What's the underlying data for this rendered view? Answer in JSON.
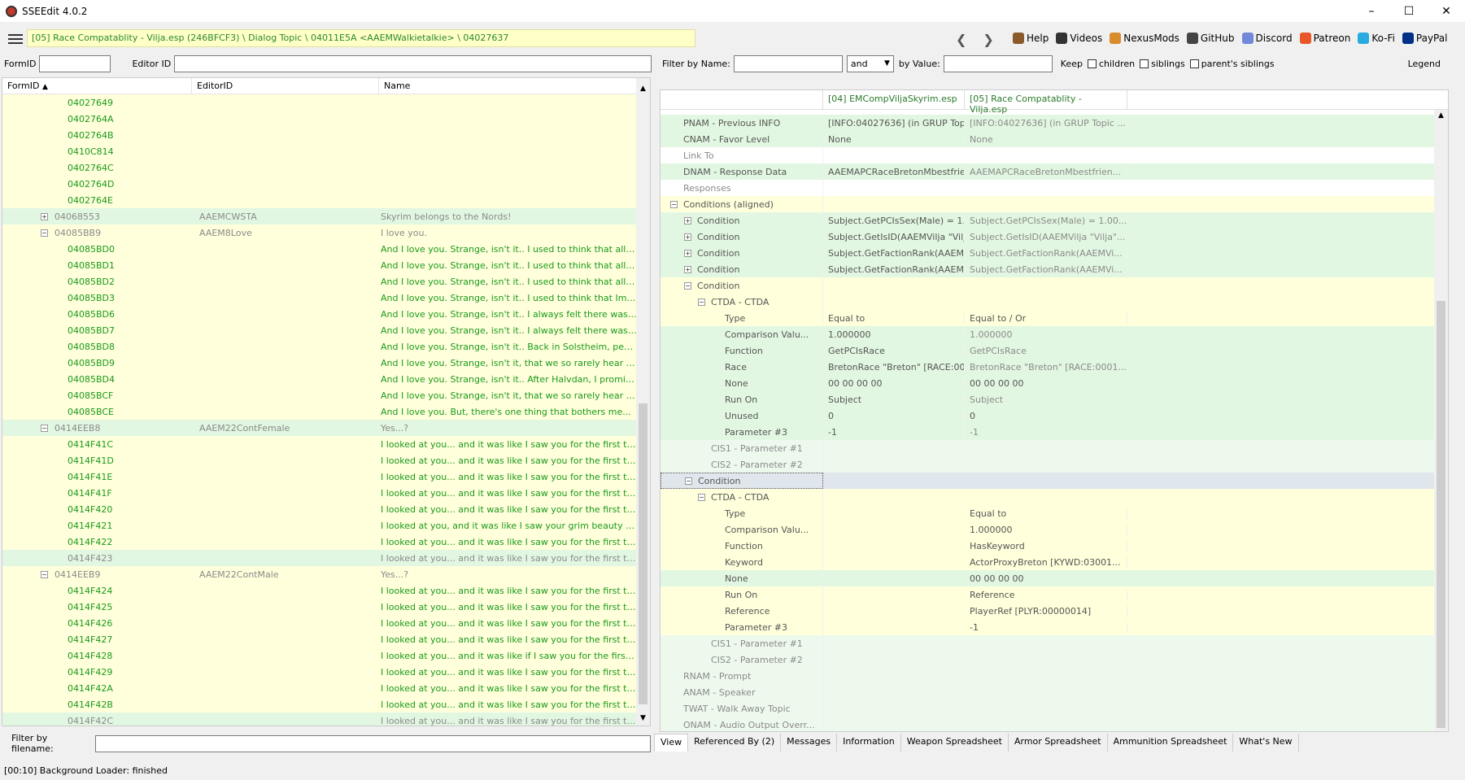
{
  "window": {
    "title": "SSEEdit 4.0.2",
    "minimize": "–",
    "maximize": "☐",
    "close": "✕"
  },
  "toolbar": {
    "path": "[05] Race Compatablity - Vilja.esp (246BFCF3) \\ Dialog Topic \\ 04011E5A <AAEMWalkietalkie> \\ 04027637",
    "back": "❮",
    "forward": "❯",
    "links": [
      {
        "label": "Help",
        "icon": "book-icon",
        "color": "#8b5a2b"
      },
      {
        "label": "Videos",
        "icon": "videos-icon",
        "color": "#333"
      },
      {
        "label": "NexusMods",
        "icon": "nexusmods-icon",
        "color": "#d98c2b"
      },
      {
        "label": "GitHub",
        "icon": "github-icon",
        "color": "#444"
      },
      {
        "label": "Discord",
        "icon": "discord-icon",
        "color": "#7289da"
      },
      {
        "label": "Patreon",
        "icon": "patreon-icon",
        "color": "#e8562a"
      },
      {
        "label": "Ko-Fi",
        "icon": "kofi-icon",
        "color": "#29abe0"
      },
      {
        "label": "PayPal",
        "icon": "paypal-icon",
        "color": "#003087"
      }
    ]
  },
  "left": {
    "formid_label": "FormID",
    "editorid_label": "Editor ID",
    "columns": [
      "FormID",
      "EditorID",
      "Name"
    ],
    "rows": [
      {
        "id": "04027649",
        "eid": "",
        "name": "",
        "bg": "y",
        "lvl": 2,
        "idc": "tg",
        "nc": "tg"
      },
      {
        "id": "0402764A",
        "eid": "",
        "name": "",
        "bg": "y",
        "lvl": 2,
        "idc": "tg",
        "nc": "tg"
      },
      {
        "id": "0402764B",
        "eid": "",
        "name": "",
        "bg": "y",
        "lvl": 2,
        "idc": "tg",
        "nc": "tg"
      },
      {
        "id": "0410C814",
        "eid": "",
        "name": "",
        "bg": "y",
        "lvl": 2,
        "idc": "tg",
        "nc": "tg"
      },
      {
        "id": "0402764C",
        "eid": "",
        "name": "",
        "bg": "y",
        "lvl": 2,
        "idc": "tg",
        "nc": "tg"
      },
      {
        "id": "0402764D",
        "eid": "",
        "name": "",
        "bg": "y",
        "lvl": 2,
        "idc": "tg",
        "nc": "tg"
      },
      {
        "id": "0402764E",
        "eid": "",
        "name": "",
        "bg": "y",
        "lvl": 2,
        "idc": "tg",
        "nc": "tg"
      },
      {
        "id": "04068553",
        "eid": "AAEMCWSTA",
        "name": "Skyrim belongs to the Nords!",
        "bg": "g",
        "lvl": 1,
        "pm": "+",
        "idc": "tgr",
        "nc": "tgr"
      },
      {
        "id": "04085BB9",
        "eid": "AAEM8Love",
        "name": "I love you.",
        "bg": "y",
        "lvl": 1,
        "pm": "−",
        "idc": "tgr",
        "nc": "tgr"
      },
      {
        "id": "04085BD0",
        "eid": "",
        "name": "And I love you. Strange, isn't it.. I used to think that all B...",
        "bg": "y",
        "lvl": 2,
        "idc": "tg",
        "nc": "tg"
      },
      {
        "id": "04085BD1",
        "eid": "",
        "name": "And I love you. Strange, isn't it.. I used to think that all A...",
        "bg": "y",
        "lvl": 2,
        "idc": "tg",
        "nc": "tg"
      },
      {
        "id": "04085BD2",
        "eid": "",
        "name": "And I love you. Strange, isn't it.. I used to think that all D...",
        "bg": "y",
        "lvl": 2,
        "idc": "tg",
        "nc": "tg"
      },
      {
        "id": "04085BD3",
        "eid": "",
        "name": "And I love you. Strange, isn't it.. I used to think that Imp...",
        "bg": "y",
        "lvl": 2,
        "idc": "tg",
        "nc": "tg"
      },
      {
        "id": "04085BD6",
        "eid": "",
        "name": "And I love you. Strange, isn't it.. I always felt there was s...",
        "bg": "y",
        "lvl": 2,
        "idc": "tg",
        "nc": "tg"
      },
      {
        "id": "04085BD7",
        "eid": "",
        "name": "And I love you. Strange, isn't it.. I always felt there was s...",
        "bg": "y",
        "lvl": 2,
        "idc": "tg",
        "nc": "tg"
      },
      {
        "id": "04085BD8",
        "eid": "",
        "name": "And I love you. Strange, isn't it.. Back in Solstheim, peopl...",
        "bg": "y",
        "lvl": 2,
        "idc": "tg",
        "nc": "tg"
      },
      {
        "id": "04085BD9",
        "eid": "",
        "name": "And I love you. Strange, isn't it, that we so rarely hear of ...",
        "bg": "y",
        "lvl": 2,
        "idc": "tg",
        "nc": "tg"
      },
      {
        "id": "04085BD4",
        "eid": "",
        "name": "And I love you. Strange, isn't it.. After Halvdan, I promis...",
        "bg": "y",
        "lvl": 2,
        "idc": "tg",
        "nc": "tg"
      },
      {
        "id": "04085BCF",
        "eid": "",
        "name": "And I love you. Strange, isn't it, that we so rarely hear of ...",
        "bg": "y",
        "lvl": 2,
        "idc": "tg",
        "nc": "tg"
      },
      {
        "id": "04085BCE",
        "eid": "",
        "name": "And I love you. But, there's one thing that bothers me...",
        "bg": "y",
        "lvl": 2,
        "idc": "tg",
        "nc": "tg"
      },
      {
        "id": "0414EEB8",
        "eid": "AAEM22ContFemale",
        "name": "Yes...?",
        "bg": "g",
        "lvl": 1,
        "pm": "−",
        "idc": "tgr",
        "nc": "tgr"
      },
      {
        "id": "0414F41C",
        "eid": "",
        "name": "I looked at you... and it was like I saw you for the first ti...",
        "bg": "y",
        "lvl": 2,
        "idc": "tg",
        "nc": "tg"
      },
      {
        "id": "0414F41D",
        "eid": "",
        "name": "I looked at you... and it was like I saw you for the first ti...",
        "bg": "y",
        "lvl": 2,
        "idc": "tg",
        "nc": "tg"
      },
      {
        "id": "0414F41E",
        "eid": "",
        "name": "I looked at you... and it was like I saw you for the first ti...",
        "bg": "y",
        "lvl": 2,
        "idc": "tg",
        "nc": "tg"
      },
      {
        "id": "0414F41F",
        "eid": "",
        "name": "I looked at you... and it was like I saw you for the first ti...",
        "bg": "y",
        "lvl": 2,
        "idc": "tg",
        "nc": "tg"
      },
      {
        "id": "0414F420",
        "eid": "",
        "name": "I looked at you... and it was like I saw you for the first ti...",
        "bg": "y",
        "lvl": 2,
        "idc": "tg",
        "nc": "tg"
      },
      {
        "id": "0414F421",
        "eid": "",
        "name": "I looked at you, and it was like I saw your grim beauty fo...",
        "bg": "y",
        "lvl": 2,
        "idc": "tg",
        "nc": "tg"
      },
      {
        "id": "0414F422",
        "eid": "",
        "name": "I looked at you... and it was like I saw you for the first ti...",
        "bg": "y",
        "lvl": 2,
        "idc": "tg",
        "nc": "tg"
      },
      {
        "id": "0414F423",
        "eid": "",
        "name": "I looked at you... and it was like I saw you for the first ti...",
        "bg": "g",
        "lvl": 2,
        "idc": "tgr",
        "nc": "tgr"
      },
      {
        "id": "0414EEB9",
        "eid": "AAEM22ContMale",
        "name": "Yes...?",
        "bg": "y",
        "lvl": 1,
        "pm": "−",
        "idc": "tgr",
        "nc": "tgr"
      },
      {
        "id": "0414F424",
        "eid": "",
        "name": "I looked at you... and it was like I saw you for the first ti...",
        "bg": "y",
        "lvl": 2,
        "idc": "tg",
        "nc": "tg"
      },
      {
        "id": "0414F425",
        "eid": "",
        "name": "I looked at you... and it was like I saw you for the first ti...",
        "bg": "y",
        "lvl": 2,
        "idc": "tg",
        "nc": "tg"
      },
      {
        "id": "0414F426",
        "eid": "",
        "name": "I looked at you... and it was like I saw you for the first ti...",
        "bg": "y",
        "lvl": 2,
        "idc": "tg",
        "nc": "tg"
      },
      {
        "id": "0414F427",
        "eid": "",
        "name": "I looked at you... and it was like I saw you for the first ti...",
        "bg": "y",
        "lvl": 2,
        "idc": "tg",
        "nc": "tg"
      },
      {
        "id": "0414F428",
        "eid": "",
        "name": "I looked at you... and it was like if I saw you for the first t...",
        "bg": "y",
        "lvl": 2,
        "idc": "tg",
        "nc": "tg"
      },
      {
        "id": "0414F429",
        "eid": "",
        "name": "I looked at you... and it was like I saw you for the first ti...",
        "bg": "y",
        "lvl": 2,
        "idc": "tg",
        "nc": "tg"
      },
      {
        "id": "0414F42A",
        "eid": "",
        "name": "I looked at you... and it was like I saw you for the first ti...",
        "bg": "y",
        "lvl": 2,
        "idc": "tg",
        "nc": "tg"
      },
      {
        "id": "0414F42B",
        "eid": "",
        "name": "I looked at you... and it was like I saw you for the first ti...",
        "bg": "y",
        "lvl": 2,
        "idc": "tg",
        "nc": "tg"
      },
      {
        "id": "0414F42C",
        "eid": "",
        "name": "I looked at you... and it was like I saw you for the first ti...",
        "bg": "g",
        "lvl": 2,
        "idc": "tgr",
        "nc": "tgr"
      }
    ],
    "filter_label": "Filter by filename:"
  },
  "status": "[00:10] Background Loader: finished",
  "right": {
    "filter_name_label": "Filter by Name:",
    "and_value": "and",
    "by_value_label": "by Value:",
    "keep_label": "Keep",
    "children_label": "children",
    "siblings_label": "siblings",
    "parents_siblings_label": "parent's siblings",
    "legend_label": "Legend",
    "col1": "[04] EMCompViljaSkyrim.esp",
    "col2": "[05] Race Compatablity - Vilja.esp",
    "rows": [
      {
        "k": "PNAM - Previous INFO",
        "v1": "[INFO:04027636] (in GRUP Topic ...",
        "v2": "[INFO:04027636] (in GRUP Topic ...",
        "bg": "g",
        "lvl": 0,
        "kc": "tbk",
        "c1": "tbk",
        "c2": "tgr"
      },
      {
        "k": "CNAM - Favor Level",
        "v1": "None",
        "v2": "None",
        "bg": "g",
        "lvl": 0,
        "kc": "tbk",
        "c1": "tbk",
        "c2": "tgr"
      },
      {
        "k": "Link To",
        "v1": "",
        "v2": "",
        "bg": "w",
        "lvl": 0,
        "kc": "tgr",
        "c1": "tbk",
        "c2": "tgr"
      },
      {
        "k": "DNAM - Response Data",
        "v1": "AAEMAPCRaceBretonMbestfrien...",
        "v2": "AAEMAPCRaceBretonMbestfrien...",
        "bg": "g",
        "lvl": 0,
        "kc": "tbk",
        "c1": "tbk",
        "c2": "tgr"
      },
      {
        "k": "Responses",
        "v1": "",
        "v2": "",
        "bg": "w",
        "lvl": 0,
        "kc": "tgr",
        "c1": "tbk",
        "c2": "tgr"
      },
      {
        "k": "Conditions (aligned)",
        "v1": "",
        "v2": "",
        "bg": "y",
        "lvl": 0,
        "pm": "−",
        "kc": "tbk",
        "c1": "tbk",
        "c2": "tgr"
      },
      {
        "k": "Condition",
        "v1": "Subject.GetPCIsSex(Male) = 1.00...",
        "v2": "Subject.GetPCIsSex(Male) = 1.00...",
        "bg": "g",
        "lvl": 1,
        "pm": "+",
        "kc": "tbk",
        "c1": "tbk",
        "c2": "tgr"
      },
      {
        "k": "Condition",
        "v1": "Subject.GetIsID(AAEMVilja \"Vilja\"...",
        "v2": "Subject.GetIsID(AAEMVilja \"Vilja\"...",
        "bg": "g",
        "lvl": 1,
        "pm": "+",
        "kc": "tbk",
        "c1": "tbk",
        "c2": "tgr"
      },
      {
        "k": "Condition",
        "v1": "Subject.GetFactionRank(AAEMVi...",
        "v2": "Subject.GetFactionRank(AAEMVi...",
        "bg": "g",
        "lvl": 1,
        "pm": "+",
        "kc": "tbk",
        "c1": "tbk",
        "c2": "tgr"
      },
      {
        "k": "Condition",
        "v1": "Subject.GetFactionRank(AAEMVi...",
        "v2": "Subject.GetFactionRank(AAEMVi...",
        "bg": "g",
        "lvl": 1,
        "pm": "+",
        "kc": "tbk",
        "c1": "tbk",
        "c2": "tgr"
      },
      {
        "k": "Condition",
        "v1": "",
        "v2": "",
        "bg": "y",
        "lvl": 1,
        "pm": "−",
        "kc": "tbk",
        "c1": "tbk",
        "c2": "tgr"
      },
      {
        "k": "CTDA - CTDA",
        "v1": "",
        "v2": "",
        "bg": "y",
        "lvl": 2,
        "pm": "−",
        "kc": "tbk",
        "c1": "tbk",
        "c2": "tgr"
      },
      {
        "k": "Type",
        "v1": "Equal to",
        "v2": "Equal to / Or",
        "bg": "y",
        "lvl": 3,
        "kc": "tbk",
        "c1": "tbk",
        "c2": "tbk"
      },
      {
        "k": "Comparison Valu...",
        "v1": "1.000000",
        "v2": "1.000000",
        "bg": "g",
        "lvl": 3,
        "kc": "tbk",
        "c1": "tbk",
        "c2": "tgr"
      },
      {
        "k": "Function",
        "v1": "GetPCIsRace",
        "v2": "GetPCIsRace",
        "bg": "g",
        "lvl": 3,
        "kc": "tbk",
        "c1": "tbk",
        "c2": "tgr"
      },
      {
        "k": "Race",
        "v1": "BretonRace \"Breton\" [RACE:0001...",
        "v2": "BretonRace \"Breton\" [RACE:0001...",
        "bg": "g",
        "lvl": 3,
        "kc": "tbk",
        "c1": "tbk",
        "c2": "tgr"
      },
      {
        "k": "None",
        "v1": "00 00 00 00",
        "v2": "00 00 00 00",
        "bg": "g",
        "lvl": 3,
        "kc": "tbk",
        "c1": "tbk",
        "c2": "tbk"
      },
      {
        "k": "Run On",
        "v1": "Subject",
        "v2": "Subject",
        "bg": "g",
        "lvl": 3,
        "kc": "tbk",
        "c1": "tbk",
        "c2": "tgr"
      },
      {
        "k": "Unused",
        "v1": "0",
        "v2": "0",
        "bg": "g",
        "lvl": 3,
        "kc": "tbk",
        "c1": "tbk",
        "c2": "tbk"
      },
      {
        "k": "Parameter #3",
        "v1": "-1",
        "v2": "-1",
        "bg": "g",
        "lvl": 3,
        "kc": "tbk",
        "c1": "tbk",
        "c2": "tgr"
      },
      {
        "k": "CIS1 - Parameter #1",
        "v1": "",
        "v2": "",
        "bg": "lg",
        "lvl": 2,
        "kc": "tgr",
        "c1": "tbk",
        "c2": "tgr"
      },
      {
        "k": "CIS2 - Parameter #2",
        "v1": "",
        "v2": "",
        "bg": "lg",
        "lvl": 2,
        "kc": "tgr",
        "c1": "tbk",
        "c2": "tgr"
      },
      {
        "k": "Condition",
        "v1": "",
        "v2": "",
        "bg": "sel",
        "lvl": 1,
        "pm": "−",
        "kc": "tbk",
        "c1": "tbk",
        "c2": "tgr"
      },
      {
        "k": "CTDA - CTDA",
        "v1": "",
        "v2": "",
        "bg": "y",
        "lvl": 2,
        "pm": "−",
        "kc": "tbk",
        "c1": "tbk",
        "c2": "tgr"
      },
      {
        "k": "Type",
        "v1": "",
        "v2": "Equal to",
        "bg": "y",
        "lvl": 3,
        "kc": "tbk",
        "c1": "tbk",
        "c2": "tbk"
      },
      {
        "k": "Comparison Valu...",
        "v1": "",
        "v2": "1.000000",
        "bg": "y",
        "lvl": 3,
        "kc": "tbk",
        "c1": "tbk",
        "c2": "tbk"
      },
      {
        "k": "Function",
        "v1": "",
        "v2": "HasKeyword",
        "bg": "y",
        "lvl": 3,
        "kc": "tbk",
        "c1": "tbk",
        "c2": "tbk"
      },
      {
        "k": "Keyword",
        "v1": "",
        "v2": "ActorProxyBreton [KYWD:03001...",
        "bg": "y",
        "lvl": 3,
        "kc": "tbk",
        "c1": "tbk",
        "c2": "tbk"
      },
      {
        "k": "None",
        "v1": "",
        "v2": "00 00 00 00",
        "bg": "g",
        "lvl": 3,
        "kc": "tbk",
        "c1": "tbk",
        "c2": "tbk"
      },
      {
        "k": "Run On",
        "v1": "",
        "v2": "Reference",
        "bg": "y",
        "lvl": 3,
        "kc": "tbk",
        "c1": "tbk",
        "c2": "tbk"
      },
      {
        "k": "Reference",
        "v1": "",
        "v2": "PlayerRef [PLYR:00000014]",
        "bg": "y",
        "lvl": 3,
        "kc": "tbk",
        "c1": "tbk",
        "c2": "tbk"
      },
      {
        "k": "Parameter #3",
        "v1": "",
        "v2": "-1",
        "bg": "y",
        "lvl": 3,
        "kc": "tbk",
        "c1": "tbk",
        "c2": "tbk"
      },
      {
        "k": "CIS1 - Parameter #1",
        "v1": "",
        "v2": "",
        "bg": "lg",
        "lvl": 2,
        "kc": "tgr",
        "c1": "tbk",
        "c2": "tgr"
      },
      {
        "k": "CIS2 - Parameter #2",
        "v1": "",
        "v2": "",
        "bg": "lg",
        "lvl": 2,
        "kc": "tgr",
        "c1": "tbk",
        "c2": "tgr"
      },
      {
        "k": "RNAM - Prompt",
        "v1": "",
        "v2": "",
        "bg": "lg",
        "lvl": 0,
        "kc": "tgr",
        "c1": "tbk",
        "c2": "tgr"
      },
      {
        "k": "ANAM - Speaker",
        "v1": "",
        "v2": "",
        "bg": "lg",
        "lvl": 0,
        "kc": "tgr",
        "c1": "tbk",
        "c2": "tgr"
      },
      {
        "k": "TWAT - Walk Away Topic",
        "v1": "",
        "v2": "",
        "bg": "lg",
        "lvl": 0,
        "kc": "tgr",
        "c1": "tbk",
        "c2": "tgr"
      },
      {
        "k": "ONAM - Audio Output Overr...",
        "v1": "",
        "v2": "",
        "bg": "lg",
        "lvl": 0,
        "kc": "tgr",
        "c1": "tbk",
        "c2": "tgr"
      }
    ],
    "tabs": [
      "View",
      "Referenced By (2)",
      "Messages",
      "Information",
      "Weapon Spreadsheet",
      "Armor Spreadsheet",
      "Ammunition Spreadsheet",
      "What's New"
    ]
  }
}
